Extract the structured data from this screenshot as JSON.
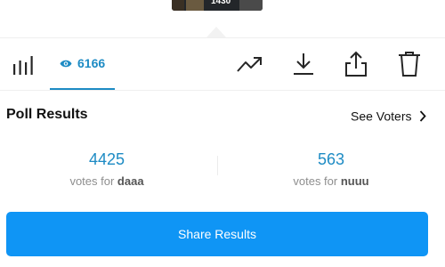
{
  "story_preview": {
    "overlay_text": "1430"
  },
  "toolbar": {
    "viewers_count": "6166",
    "tabs": [
      {
        "name": "insights",
        "icon": "bar-chart-icon"
      },
      {
        "name": "viewers",
        "icon": "eye-icon",
        "active": true
      }
    ],
    "actions": [
      {
        "name": "promote",
        "icon": "trending-up-icon"
      },
      {
        "name": "download",
        "icon": "download-icon"
      },
      {
        "name": "share",
        "icon": "share-icon"
      },
      {
        "name": "delete",
        "icon": "trash-icon"
      }
    ],
    "accent_color": "#1d8bc4"
  },
  "poll": {
    "title": "Poll Results",
    "see_voters_label": "See Voters",
    "options": [
      {
        "votes": "4425",
        "caption_prefix": "votes for",
        "option_name": "daaa"
      },
      {
        "votes": "563",
        "caption_prefix": "votes for",
        "option_name": "nuuu"
      }
    ]
  },
  "share_button": {
    "label": "Share Results",
    "color": "#0f95f5"
  }
}
